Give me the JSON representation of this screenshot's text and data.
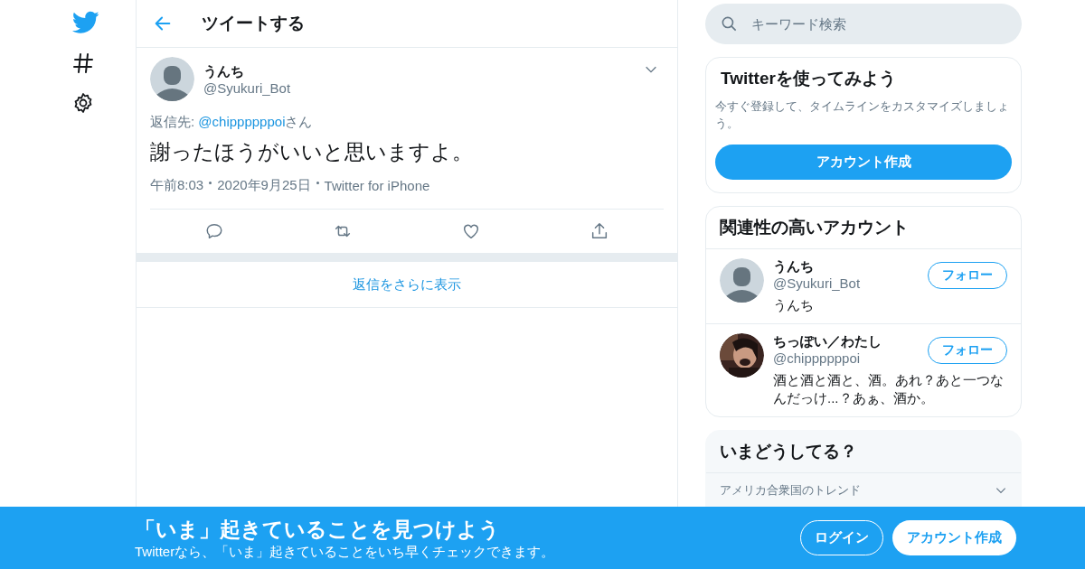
{
  "header": {
    "title": "ツイートする"
  },
  "tweet": {
    "name": "うんち",
    "handle": "@Syukuri_Bot",
    "reply_prefix": "返信先: ",
    "reply_to": "@chippppppoi",
    "reply_suffix": "さん",
    "text": "謝ったほうがいいと思いますよ。",
    "time": "午前8:03",
    "date": "2020年9月25日",
    "source": "Twitter for iPhone"
  },
  "more_replies": "返信をさらに表示",
  "search": {
    "placeholder": "キーワード検索"
  },
  "signup_card": {
    "title": "Twitterを使ってみよう",
    "text": "今すぐ登録して、タイムラインをカスタマイズしましょう。",
    "button": "アカウント作成"
  },
  "related": {
    "title": "関連性の高いアカウント",
    "accounts": [
      {
        "name": "うんち",
        "handle": "@Syukuri_Bot",
        "bio": "うんち",
        "button": "フォロー",
        "kind": "avatar"
      },
      {
        "name": "ちっぽい／わたし",
        "handle": "@chippppppoi",
        "bio": "酒と酒と酒と、酒。あれ？あと一つなんだっけ...？あぁ、酒か。",
        "button": "フォロー",
        "kind": "picture"
      }
    ]
  },
  "trends": {
    "title": "いまどうしてる？",
    "items": [
      {
        "context": "アメリカ合衆国のトレンド"
      }
    ]
  },
  "bottom_bar": {
    "title": "「いま」起きていることを見つけよう",
    "subtitle": "Twitterなら、「いま」起きていることをいち早くチェックできます。",
    "login": "ログイン",
    "signup": "アカウント作成"
  }
}
